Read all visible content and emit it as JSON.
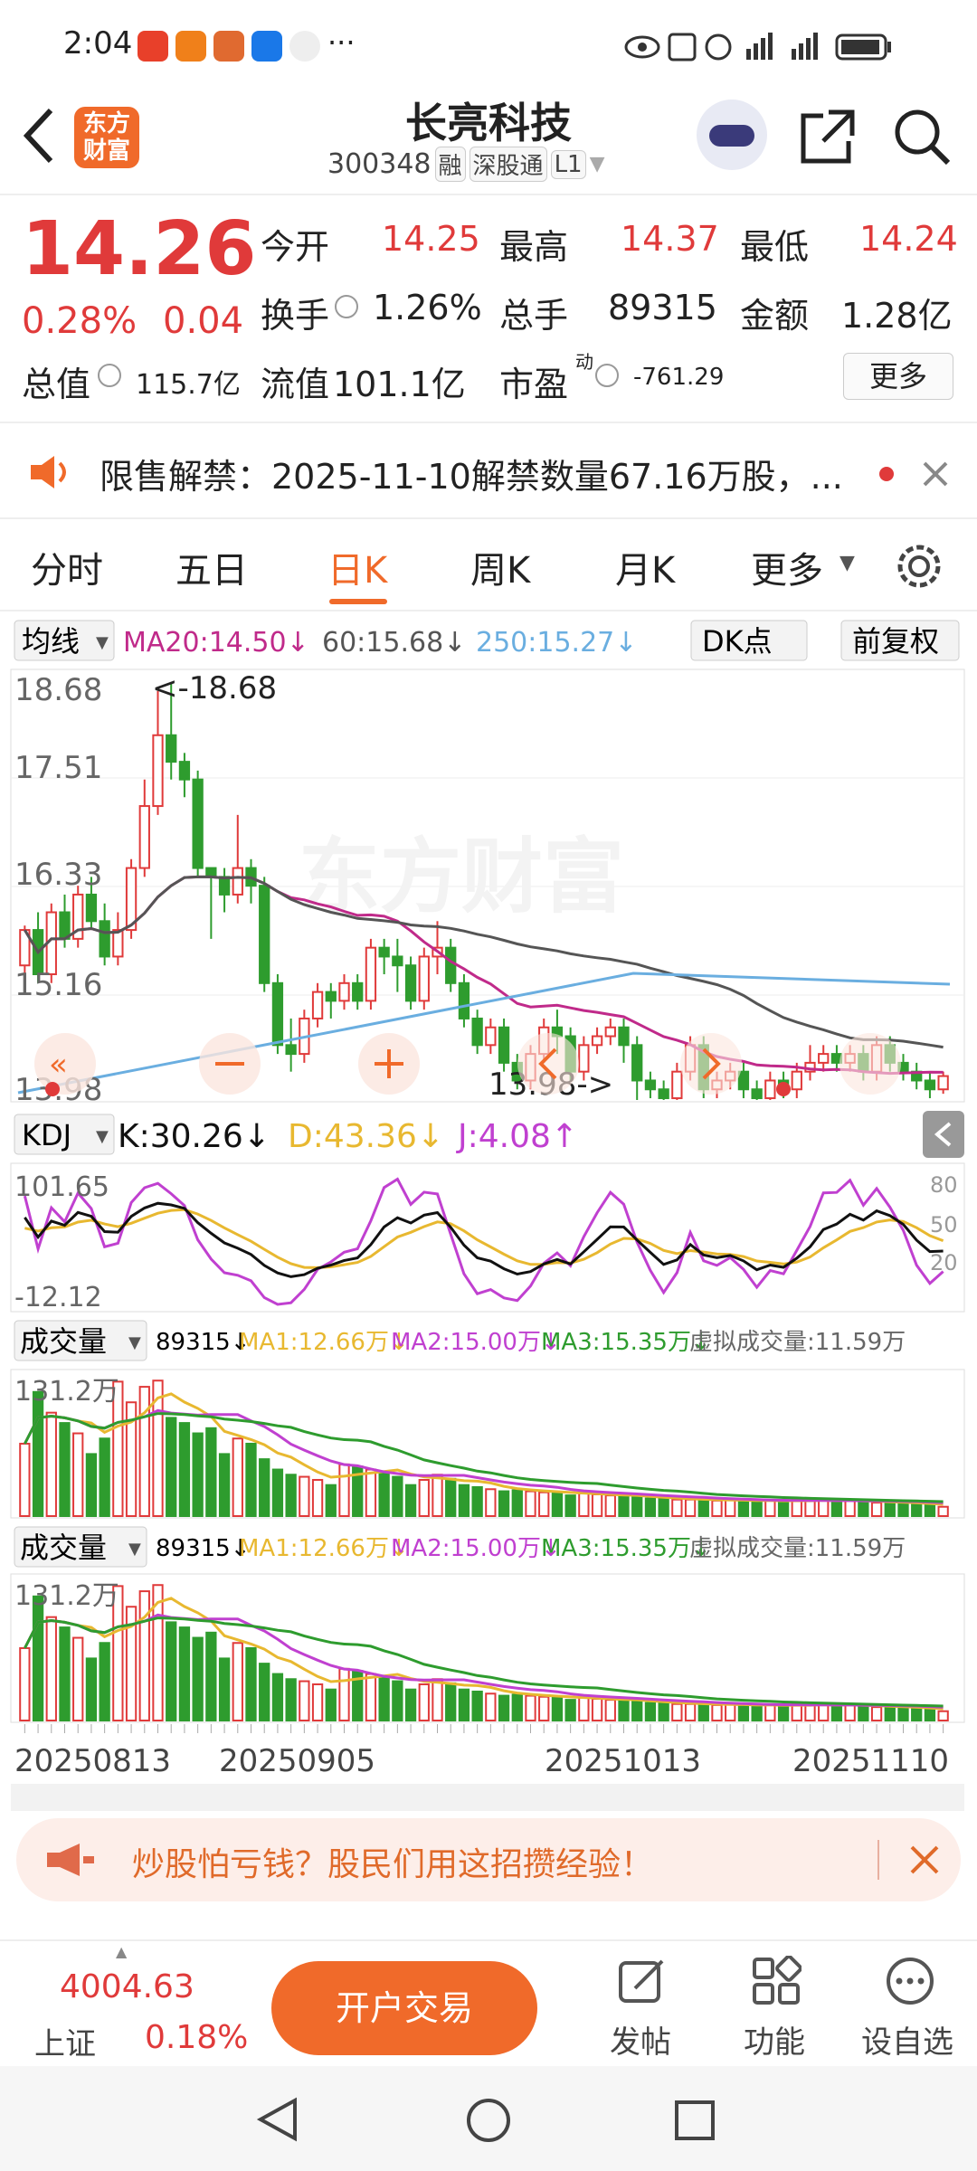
{
  "status": {
    "time": "2:04",
    "dots": "···"
  },
  "header": {
    "brand": "东方财富",
    "title": "长亮科技",
    "code": "300348",
    "tags": [
      "融",
      "深股通",
      "L1"
    ]
  },
  "quote": {
    "price": "14.26",
    "pct": "0.28%",
    "chg": "0.04",
    "rows": [
      [
        {
          "k": "今开",
          "v": "14.25"
        },
        {
          "k": "最高",
          "v": "14.37"
        },
        {
          "k": "最低",
          "v": "14.24"
        }
      ],
      [
        {
          "k": "换手",
          "v": "1.26%"
        },
        {
          "k": "总手",
          "v": "89315"
        },
        {
          "k": "金额",
          "v": "1.28亿"
        }
      ]
    ],
    "mktcap_k": "总值",
    "mktcap_v": "115.7亿",
    "float_k": "流值",
    "float_v": "101.1亿",
    "pe_k": "市盈",
    "pe_sup": "动",
    "pe_v": "-761.29",
    "more": "更多"
  },
  "notice": {
    "text": "限售解禁：2025-11-10解禁数量67.16万股，..."
  },
  "tabs": [
    "分时",
    "五日",
    "日K",
    "周K",
    "月K",
    "更多"
  ],
  "ma": {
    "btn": "均线",
    "ma20": "MA20:14.50↓",
    "ma60": "60:15.68↓",
    "ma250": "250:15.27↓",
    "dk": "DK点",
    "adj": "前复权"
  },
  "kchart": {
    "hi": "18.68",
    "l2": "17.51",
    "l3": "16.33",
    "l4": "15.16",
    "lo": "13.98",
    "hi_mark": "<-18.68",
    "lo_mark": "13.98->"
  },
  "kdj": {
    "btn": "KDJ",
    "k": "K:30.26↓",
    "d": "D:43.36↓",
    "j": "J:4.08↑",
    "top": "101.65",
    "bot": "-12.12",
    "r80": "80",
    "r50": "50",
    "r20": "20"
  },
  "vol1": {
    "btn": "成交量",
    "v": "89315↓",
    "ma1": "MA1:12.66万↓",
    "ma2": "MA2:15.00万↓",
    "ma3": "MA3:15.35万↓",
    "virt": "虚拟成交量:11.59万",
    "max": "131.2万"
  },
  "vol2": {
    "btn": "成交量",
    "v": "89315↓",
    "ma1": "MA1:12.66万↓",
    "ma2": "MA2:15.00万↓",
    "ma3": "MA3:15.35万↓",
    "virt": "虚拟成交量:11.59万",
    "max": "131.2万"
  },
  "dates": [
    "20250813",
    "20250905",
    "20251013",
    "20251110"
  ],
  "ad": {
    "text": "炒股怕亏钱？股民们用这招攒经验！"
  },
  "bottom": {
    "index_val": "4004.63",
    "index_name": "上证",
    "index_pct": "0.18%",
    "trade": "开户交易",
    "post": "发帖",
    "func": "功能",
    "watch": "设自选"
  },
  "colors": {
    "up": "#e03a3a",
    "down": "#2e9c2e",
    "orange": "#f06a2a",
    "ma20": "#c02a8a",
    "ma60": "#555555",
    "ma250": "#6aaee0",
    "kdj_k": "#111111",
    "kdj_d": "#e8b830",
    "kdj_j": "#c040d0"
  },
  "chart_data": {
    "type": "candlestick",
    "price_axis_ticks": [
      18.68,
      17.51,
      16.33,
      15.16,
      13.98
    ],
    "ylim": [
      13.98,
      18.68
    ],
    "candles": [
      [
        15.5,
        15.9,
        15.3,
        15.95
      ],
      [
        15.9,
        15.4,
        15.3,
        16.1
      ],
      [
        15.4,
        16.1,
        15.3,
        16.2
      ],
      [
        16.1,
        15.8,
        15.7,
        16.3
      ],
      [
        15.8,
        16.3,
        15.7,
        16.4
      ],
      [
        16.3,
        16.0,
        15.9,
        16.5
      ],
      [
        16.0,
        15.6,
        15.5,
        16.2
      ],
      [
        15.6,
        15.9,
        15.5,
        16.1
      ],
      [
        15.9,
        16.6,
        15.8,
        16.7
      ],
      [
        16.6,
        17.3,
        16.5,
        17.6
      ],
      [
        17.3,
        18.1,
        17.2,
        18.6
      ],
      [
        18.1,
        17.8,
        17.6,
        18.68
      ],
      [
        17.8,
        17.6,
        17.4,
        17.9
      ],
      [
        17.6,
        16.6,
        16.5,
        17.7
      ],
      [
        16.6,
        16.5,
        15.8,
        16.6
      ],
      [
        16.5,
        16.3,
        16.1,
        16.6
      ],
      [
        16.3,
        16.6,
        16.2,
        17.2
      ],
      [
        16.6,
        16.4,
        16.2,
        16.7
      ],
      [
        16.4,
        15.3,
        15.2,
        16.5
      ],
      [
        15.3,
        14.6,
        14.5,
        15.4
      ],
      [
        14.6,
        14.5,
        14.3,
        14.9
      ],
      [
        14.5,
        14.9,
        14.4,
        15.0
      ],
      [
        14.9,
        15.2,
        14.8,
        15.3
      ],
      [
        15.2,
        15.1,
        14.9,
        15.3
      ],
      [
        15.1,
        15.3,
        15.0,
        15.4
      ],
      [
        15.3,
        15.1,
        15.0,
        15.4
      ],
      [
        15.1,
        15.7,
        15.0,
        15.8
      ],
      [
        15.7,
        15.6,
        15.4,
        15.8
      ],
      [
        15.6,
        15.5,
        15.2,
        15.8
      ],
      [
        15.5,
        15.1,
        15.0,
        15.6
      ],
      [
        15.1,
        15.6,
        15.0,
        15.7
      ],
      [
        15.6,
        15.7,
        15.4,
        16.0
      ],
      [
        15.7,
        15.3,
        15.2,
        15.8
      ],
      [
        15.3,
        14.9,
        14.8,
        15.4
      ],
      [
        14.9,
        14.6,
        14.5,
        15.0
      ],
      [
        14.6,
        14.8,
        14.5,
        14.9
      ],
      [
        14.8,
        14.4,
        14.3,
        14.9
      ],
      [
        14.4,
        14.2,
        14.1,
        14.5
      ],
      [
        14.2,
        14.5,
        14.1,
        14.6
      ],
      [
        14.5,
        14.8,
        14.4,
        14.9
      ],
      [
        14.8,
        14.7,
        14.5,
        15.0
      ],
      [
        14.7,
        14.3,
        14.2,
        14.8
      ],
      [
        14.3,
        14.6,
        14.2,
        14.7
      ],
      [
        14.6,
        14.7,
        14.5,
        14.8
      ],
      [
        14.7,
        14.8,
        14.6,
        14.9
      ],
      [
        14.8,
        14.6,
        14.4,
        14.9
      ],
      [
        14.6,
        14.2,
        13.98,
        14.7
      ],
      [
        14.2,
        14.1,
        14.0,
        14.3
      ],
      [
        14.1,
        14.0,
        13.98,
        14.2
      ],
      [
        14.0,
        14.3,
        13.98,
        14.4
      ],
      [
        14.3,
        14.6,
        14.2,
        14.7
      ],
      [
        14.6,
        14.1,
        14.0,
        14.7
      ],
      [
        14.1,
        14.2,
        14.0,
        14.3
      ],
      [
        14.2,
        14.3,
        14.1,
        14.4
      ],
      [
        14.3,
        14.1,
        14.0,
        14.4
      ],
      [
        14.1,
        14.0,
        13.98,
        14.2
      ],
      [
        14.0,
        14.2,
        13.98,
        14.3
      ],
      [
        14.2,
        14.1,
        14.0,
        14.3
      ],
      [
        14.1,
        14.3,
        14.0,
        14.4
      ],
      [
        14.3,
        14.4,
        14.2,
        14.6
      ],
      [
        14.4,
        14.5,
        14.3,
        14.6
      ],
      [
        14.5,
        14.4,
        14.3,
        14.6
      ],
      [
        14.4,
        14.5,
        14.3,
        14.6
      ],
      [
        14.5,
        14.3,
        14.2,
        14.6
      ],
      [
        14.3,
        14.6,
        14.2,
        14.7
      ],
      [
        14.6,
        14.4,
        14.3,
        14.7
      ],
      [
        14.4,
        14.3,
        14.2,
        14.5
      ],
      [
        14.3,
        14.2,
        14.1,
        14.4
      ],
      [
        14.2,
        14.1,
        14.0,
        14.3
      ],
      [
        14.1,
        14.25,
        14.05,
        14.3
      ]
    ],
    "volumes": [
      70,
      120,
      100,
      90,
      80,
      60,
      75,
      130,
      110,
      125,
      131,
      95,
      90,
      80,
      85,
      60,
      75,
      70,
      55,
      45,
      40,
      38,
      35,
      30,
      50,
      48,
      45,
      42,
      38,
      30,
      35,
      40,
      36,
      30,
      28,
      26,
      24,
      25,
      24,
      23,
      22,
      20,
      22,
      21,
      20,
      19,
      18,
      17,
      17,
      16,
      16,
      15,
      15,
      16,
      15,
      14,
      15,
      14,
      16,
      15,
      16,
      14,
      15,
      14,
      13,
      13,
      12,
      12,
      11,
      9
    ]
  }
}
